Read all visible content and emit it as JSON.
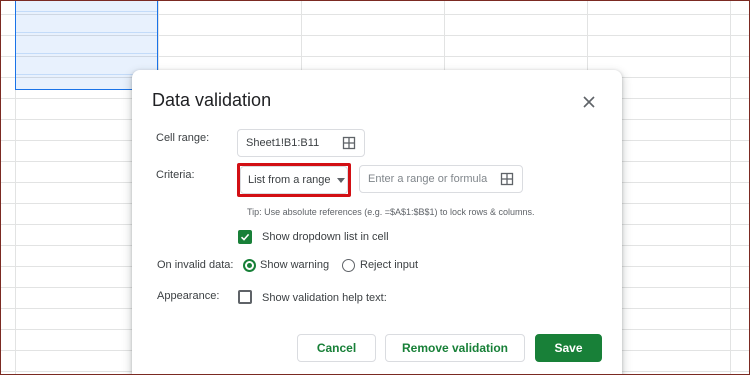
{
  "dialog": {
    "title": "Data validation",
    "close_icon": "close-icon",
    "cell_range": {
      "label": "Cell range:",
      "value": "Sheet1!B1:B11",
      "icon": "grid-icon"
    },
    "criteria": {
      "label": "Criteria:",
      "type_value": "List from a range",
      "range_placeholder": "Enter a range or formula",
      "icon": "grid-icon",
      "tip": "Tip: Use absolute references (e.g. =$A$1:$B$1) to lock rows & columns."
    },
    "show_dropdown": {
      "label": "Show dropdown list in cell",
      "checked": true
    },
    "on_invalid": {
      "label": "On invalid data:",
      "options": [
        "Show warning",
        "Reject input"
      ],
      "selected": "Show warning"
    },
    "appearance": {
      "label": "Appearance:",
      "checkbox_label": "Show validation help text:",
      "checked": false
    },
    "buttons": {
      "cancel": "Cancel",
      "remove": "Remove validation",
      "save": "Save"
    }
  },
  "colors": {
    "accent": "#188038",
    "highlight": "#d20f14",
    "selection": "#1a73e8"
  }
}
